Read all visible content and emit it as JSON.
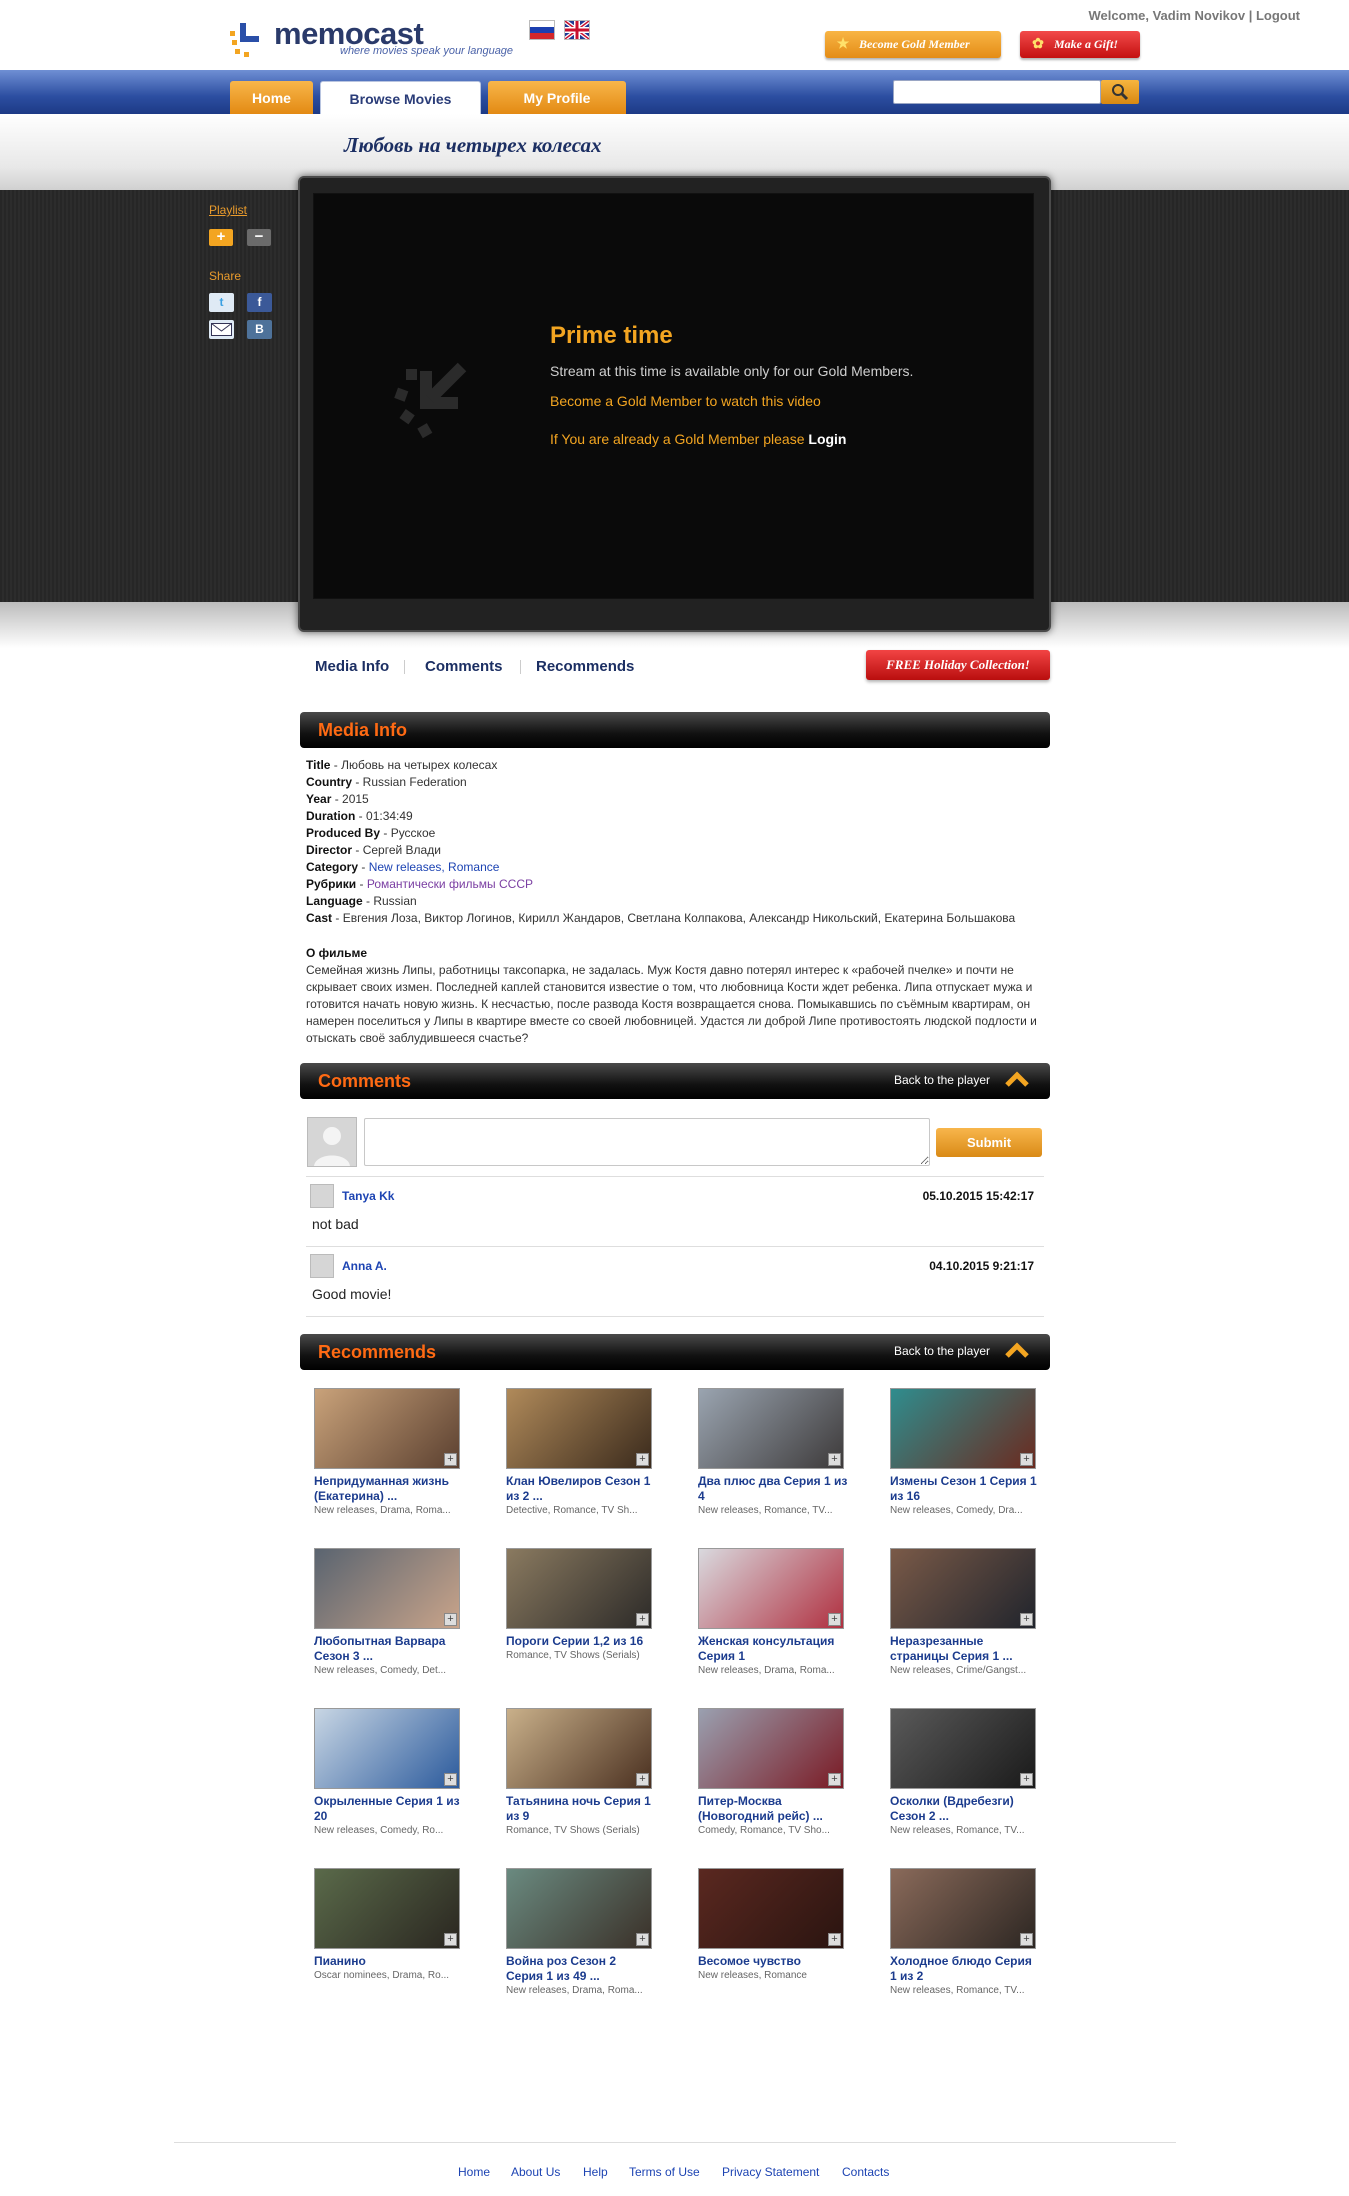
{
  "header": {
    "logo_text": "memocast",
    "tagline": "where movies speak your language",
    "welcome_text": "Welcome, Vadim Novikov",
    "separator": "|",
    "logout_label": "Logout",
    "gold_member_label": "Become Gold Member",
    "gift_label": "Make a Gift!",
    "languages": [
      "Russian",
      "English"
    ]
  },
  "nav": {
    "tabs": [
      {
        "label": "Home",
        "active": false
      },
      {
        "label": "Browse Movies",
        "active": true
      },
      {
        "label": "My Profile",
        "active": false
      }
    ],
    "search_placeholder": ""
  },
  "movie": {
    "title": "Любовь на четырех колесах"
  },
  "sidebar": {
    "playlist_label": "Playlist",
    "add_symbol": "+",
    "remove_symbol": "−",
    "share_label": "Share",
    "share_icons": [
      "twitter-icon",
      "facebook-icon",
      "mail-icon",
      "vkontakte-icon"
    ]
  },
  "player": {
    "heading": "Prime time",
    "message": "Stream at this time is available only for our Gold Members.",
    "become_link": "Become a Gold Member to watch this video",
    "login_prefix": "If You are already a Gold Member please",
    "login_label": "Login"
  },
  "subtabs": {
    "media_info": "Media Info",
    "comments": "Comments",
    "recommends": "Recommends",
    "holiday_button": "FREE Holiday Collection!"
  },
  "sections": {
    "media_info": "Media Info",
    "comments": "Comments",
    "recommends": "Recommends",
    "back_to_player": "Back to the player"
  },
  "media_info": {
    "fields": [
      {
        "label": "Title",
        "value": "Любовь на четырех колесах"
      },
      {
        "label": "Country",
        "value": "Russian Federation"
      },
      {
        "label": "Year",
        "value": "2015"
      },
      {
        "label": "Duration",
        "value": "01:34:49"
      },
      {
        "label": "Produced By",
        "value": "Русское"
      },
      {
        "label": "Director",
        "value": "Сергей Влади"
      },
      {
        "label": "Category",
        "value": "New releases, Romance"
      },
      {
        "label": "Рубрики",
        "value": "Романтически фильмы СССР"
      },
      {
        "label": "Language",
        "value": "Russian"
      },
      {
        "label": "Cast",
        "value": "Евгения Лоза, Виктор Логинов, Кирилл Жандаров, Светлана Колпакова, Александр Никольский, Екатерина Большакова"
      }
    ],
    "about_heading": "О фильме",
    "about_text": "Семейная жизнь Липы, работницы таксопарка, не задалась. Муж Костя давно потерял интерес к «рабочей пчелке» и почти не скрывает своих измен. Последней каплей становится известие о том, что любовница Кости ждет ребенка. Липа отпускает мужа и готовится начать новую жизнь. К несчастью, после развода Костя возвращается снова. Помыкавшись по съёмным квартирам, он намерен поселиться у Липы в квартире вместе со своей любовницей. Удастся ли доброй Липе противостоять людской подлости и отыскать своё заблудившееся счастье?"
  },
  "comments": {
    "submit_label": "Submit",
    "input_value": "",
    "items": [
      {
        "author": "Tanya Kk",
        "date": "05.10.2015 15:42:17",
        "text": "not bad"
      },
      {
        "author": "Anna A.",
        "date": "04.10.2015 9:21:17",
        "text": "Good movie!"
      }
    ]
  },
  "recommends": [
    {
      "title": "Непридуманная жизнь (Екатерина) ...",
      "genres": "New releases, Drama, Roma...",
      "colors": [
        "#c9a27a",
        "#5b4030"
      ]
    },
    {
      "title": "Клан Ювелиров Сезон 1 из 2 ...",
      "genres": "Detective, Romance, TV Sh...",
      "colors": [
        "#b08a5a",
        "#3a2a1c"
      ]
    },
    {
      "title": "Два плюс два Серия 1 из 4",
      "genres": "New releases, Romance, TV...",
      "colors": [
        "#9aa4b0",
        "#3d3a3a"
      ]
    },
    {
      "title": "Измены Сезон 1 Серия 1 из 16",
      "genres": "New releases, Comedy, Dra...",
      "colors": [
        "#2f8d8e",
        "#6b2a1f"
      ]
    },
    {
      "title": "Любопытная Варвара Сезон 3 ...",
      "genres": "New releases, Comedy, Det...",
      "colors": [
        "#5a6470",
        "#c9a48a"
      ]
    },
    {
      "title": "Пороги Серии 1,2 из 16",
      "genres": "Romance, TV Shows (Serials)",
      "colors": [
        "#8a7a60",
        "#2c2a28"
      ]
    },
    {
      "title": "Женская консультация Серия 1",
      "genres": "New releases, Drama, Roma...",
      "colors": [
        "#d9d9de",
        "#b03040"
      ]
    },
    {
      "title": "Неразрезанные страницы Серия 1 ...",
      "genres": "New releases, Crime/Gangst...",
      "colors": [
        "#7a5a48",
        "#20242c"
      ]
    },
    {
      "title": "Окрыленные Серия 1 из 20",
      "genres": "New releases, Comedy, Ro...",
      "colors": [
        "#c8d6e4",
        "#2b5a9c"
      ]
    },
    {
      "title": "Татьянина ночь Серия 1 из 9",
      "genres": "Romance, TV Shows (Serials)",
      "colors": [
        "#c9b08a",
        "#4a3020"
      ]
    },
    {
      "title": "Питер-Москва (Новогодний рейс) ...",
      "genres": "Comedy, Romance, TV Sho...",
      "colors": [
        "#9aa0b0",
        "#7a1a24"
      ]
    },
    {
      "title": "Осколки (Вдребезги) Сезон 2 ...",
      "genres": "New releases, Romance, TV...",
      "colors": [
        "#5a5a5a",
        "#1a1a1a"
      ]
    },
    {
      "title": "Пианино",
      "genres": "Oscar nominees, Drama, Ro...",
      "colors": [
        "#5a6a4a",
        "#2a2620"
      ]
    },
    {
      "title": "Война роз Сезон 2 Серия 1 из 49 ...",
      "genres": "New releases, Drama, Roma...",
      "colors": [
        "#6a8a80",
        "#3a3028"
      ]
    },
    {
      "title": "Весомое чувство",
      "genres": "New releases, Romance",
      "colors": [
        "#5a2820",
        "#2a1410"
      ]
    },
    {
      "title": "Холодное блюдо Серия 1 из 2",
      "genres": "New releases, Romance, TV...",
      "colors": [
        "#8a6a5a",
        "#2c2622"
      ]
    }
  ],
  "footer": {
    "links": [
      "Home",
      "About Us",
      "Help",
      "Terms of Use",
      "Privacy Statement",
      "Contacts"
    ]
  }
}
